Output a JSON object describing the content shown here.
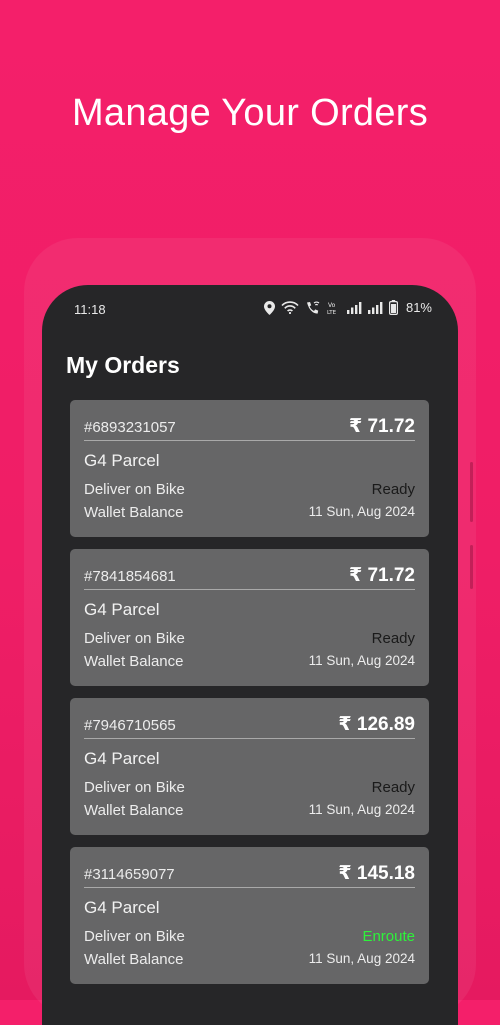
{
  "headline": "Manage Your Orders",
  "status_bar": {
    "time": "11:18",
    "battery": "81%",
    "icons": [
      "location-icon",
      "wifi-icon",
      "wifi-calling-icon",
      "volte-icon",
      "signal-icon",
      "signal-icon",
      "battery-icon"
    ]
  },
  "page_title": "My Orders",
  "orders": [
    {
      "id": "#6893231057",
      "amount": "₹ 71.72",
      "type": "G4 Parcel",
      "mode": "Deliver on Bike",
      "status": "Ready",
      "payment": "Wallet Balance",
      "date": "11 Sun, Aug 2024"
    },
    {
      "id": "#7841854681",
      "amount": "₹ 71.72",
      "type": "G4 Parcel",
      "mode": "Deliver on Bike",
      "status": "Ready",
      "payment": "Wallet Balance",
      "date": "11 Sun, Aug 2024"
    },
    {
      "id": "#7946710565",
      "amount": "₹ 126.89",
      "type": "G4 Parcel",
      "mode": "Deliver on Bike",
      "status": "Ready",
      "payment": "Wallet Balance",
      "date": "11 Sun, Aug 2024"
    },
    {
      "id": "#3114659077",
      "amount": "₹ 145.18",
      "type": "G4 Parcel",
      "mode": "Deliver on Bike",
      "status": "Enroute",
      "payment": "Wallet Balance",
      "date": "11 Sun, Aug 2024"
    }
  ],
  "colors": {
    "background": "#f41f6a",
    "phone": "#262628",
    "card": "#666667",
    "enroute": "#2df23a"
  }
}
